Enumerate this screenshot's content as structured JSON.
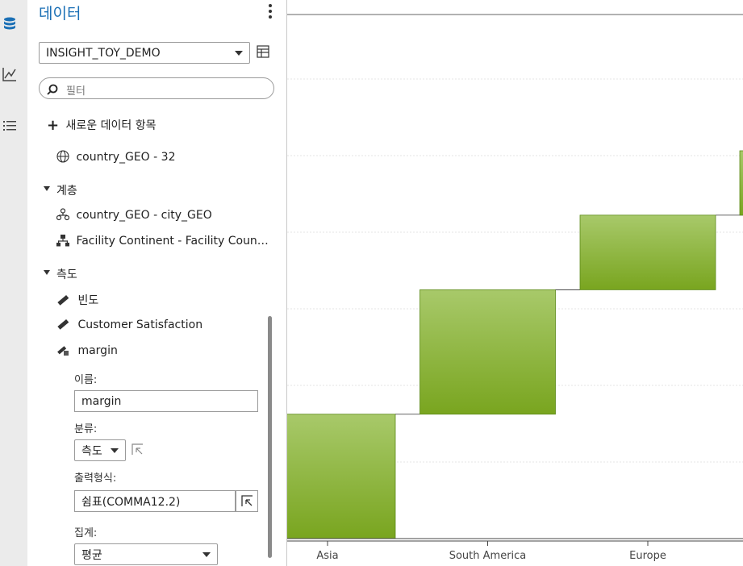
{
  "left_icons": [
    {
      "name": "data-icon",
      "active": true
    },
    {
      "name": "line-chart-icon",
      "active": false
    },
    {
      "name": "list-icon",
      "active": false
    }
  ],
  "panel": {
    "title": "데이터",
    "datasource": "INSIGHT_TOY_DEMO",
    "filter_placeholder": "필터",
    "new_item": "새로운 데이터 항목",
    "geo_item": "country_GEO - 32",
    "hierarchy_section": "계층",
    "hierarchy_items": [
      "country_GEO - city_GEO",
      "Facility Continent - Facility Coun…"
    ],
    "measure_section": "측도",
    "measure_items": [
      "빈도",
      "Customer Satisfaction",
      "margin"
    ],
    "properties": {
      "name_label": "이름:",
      "name_value": "margin",
      "class_label": "분류:",
      "class_value": "측도",
      "format_label": "출력형식:",
      "format_value": "쉼표(COMMA12.2)",
      "aggregation_label": "집계:",
      "aggregation_value": "평균"
    }
  },
  "colors": {
    "accent": "#1a6fb5",
    "bar_top": "#a8c96a",
    "bar_bottom": "#79a51f",
    "bar_stroke": "#5d8a1a"
  },
  "chart_data": {
    "type": "bar",
    "subtype": "waterfall",
    "categories": [
      "Asia",
      "South America",
      "Europe"
    ],
    "series": [
      {
        "values": [
          1.0,
          1.0,
          0.6
        ]
      }
    ],
    "ylim": [
      0,
      4.2
    ],
    "grid": true,
    "legend": "none",
    "xlabel": "",
    "ylabel": ""
  }
}
